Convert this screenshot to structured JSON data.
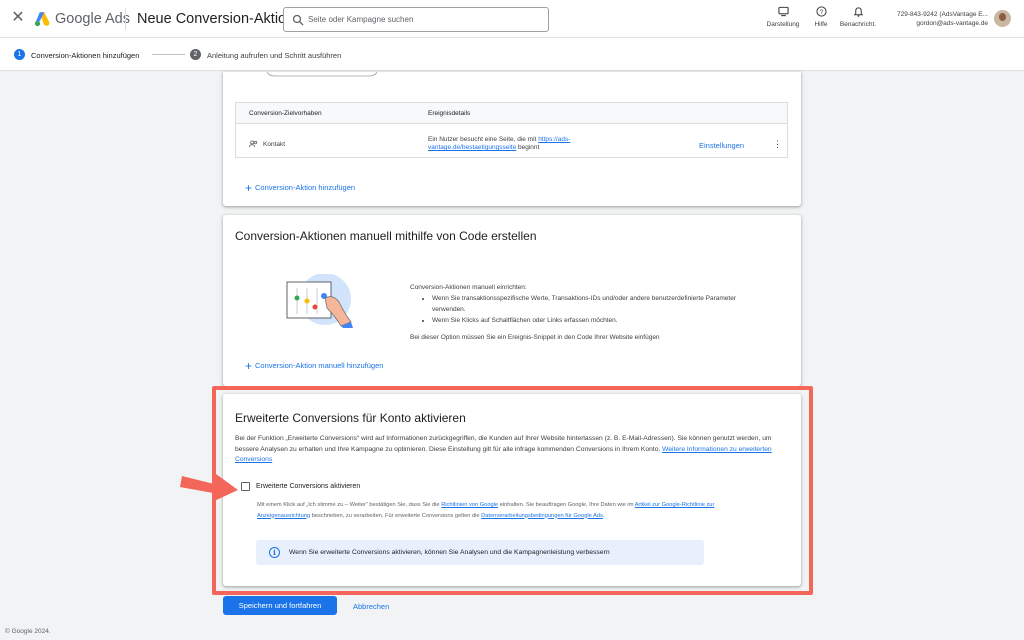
{
  "header": {
    "brand": "Google Ads",
    "page_title": "Neue Conversion-Aktion",
    "search_placeholder": "Seite oder Kampagne suchen",
    "actions": [
      {
        "label": "Darstellung",
        "icon": "appearance-icon"
      },
      {
        "label": "Hilfe",
        "icon": "help-icon"
      },
      {
        "label": "Benachricht.",
        "icon": "bell-icon"
      }
    ],
    "account_id": "729-843-9242 (AdsVantage E...",
    "account_email": "gordon@ads-vantage.de"
  },
  "stepper": {
    "steps": [
      {
        "number": "1",
        "label": "Conversion-Aktionen hinzufügen"
      },
      {
        "number": "2",
        "label": "Anleitung aufrufen und Schritt ausführen"
      }
    ]
  },
  "goals_card": {
    "table_headers": [
      "Conversion-Zielvorhaben",
      "Ereignisdetails"
    ],
    "row": {
      "goal": "Kontakt",
      "event_prefix": "Ein Nutzer besucht eine Seite, die mit ",
      "event_link": "https://ads-vantage.de/bestaetigungsseite",
      "event_suffix": " beginnt",
      "settings_link": "Einstellungen"
    },
    "add_link": "Conversion-Aktion hinzufügen"
  },
  "code_card": {
    "title": "Conversion-Aktionen manuell mithilfe von Code erstellen",
    "intro": "Conversion-Aktionen manuell einrichten:",
    "bullets": [
      "Wenn Sie transaktionsspezifische Werte, Transaktions-IDs und/oder andere benutzerdefinierte Parameter verwenden.",
      "Wenn Sie Klicks auf Schaltflächen oder Links erfassen möchten."
    ],
    "note": "Bei dieser Option müssen Sie ein Ereignis-Snippet in den Code Ihrer Website einfügen",
    "add_link": "Conversion-Aktion manuell hinzufügen"
  },
  "enhanced_card": {
    "title": "Erweiterte Conversions für Konto aktivieren",
    "description": "Bei der Funktion „Erweiterte Conversions“ wird auf Informationen zurückgegriffen, die Kunden auf Ihrer Website hinterlassen (z. B. E-Mail-Adressen). Sie können genutzt werden, um bessere Analysen zu erhalten und Ihre Kampagne zu optimieren. Diese Einstellung gilt für alle infrage kommenden Conversions in Ihrem Konto. ",
    "learn_more": "Weitere Informationen zu erweiterten Conversions",
    "checkbox_label": "Erweiterte Conversions aktivieren",
    "checkbox_checked": false,
    "consent_1": "Mit einem Klick auf „Ich stimme zu – Weiter“ bestätigen Sie, dass Sie die ",
    "consent_link_1": "Richtlinien von Google",
    "consent_2": " einhalten. Sie beauftragen Google, Ihre Daten wie im ",
    "consent_link_2": "Artikel zur Google-Richtlinie zur Anzeigenausrichtung",
    "consent_3": " beschrieben, zu verarbeiten. Für erweiterte Conversions gelten die ",
    "consent_link_3": "Datenverarbeitungsbedingungen für Google Ads",
    "consent_4": ".",
    "info": "Wenn Sie erweiterte Conversions aktivieren, können Sie Analysen und die Kampagnenleistung verbessern"
  },
  "buttons": {
    "save": "Speichern und fortfahren",
    "cancel": "Abbrechen"
  },
  "footer": "© Google 2024.",
  "colors": {
    "accent": "#1a73e8",
    "highlight": "#f4665a",
    "info_bg": "#e8f0fe"
  }
}
